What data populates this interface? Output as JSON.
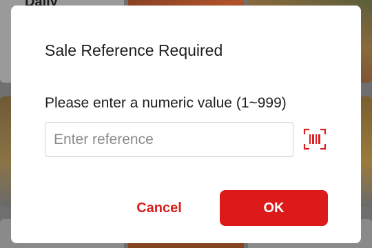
{
  "background": {
    "section_label": "Daily"
  },
  "dialog": {
    "title": "Sale Reference Required",
    "prompt": "Please enter a numeric value (1~999)",
    "input": {
      "value": "",
      "placeholder": "Enter reference"
    },
    "scan_icon": "barcode-scan-icon",
    "cancel_label": "Cancel",
    "ok_label": "OK"
  },
  "colors": {
    "accent": "#dc1a1a",
    "scrim": "#6f6f6f",
    "dialog_bg": "#ffffff"
  }
}
